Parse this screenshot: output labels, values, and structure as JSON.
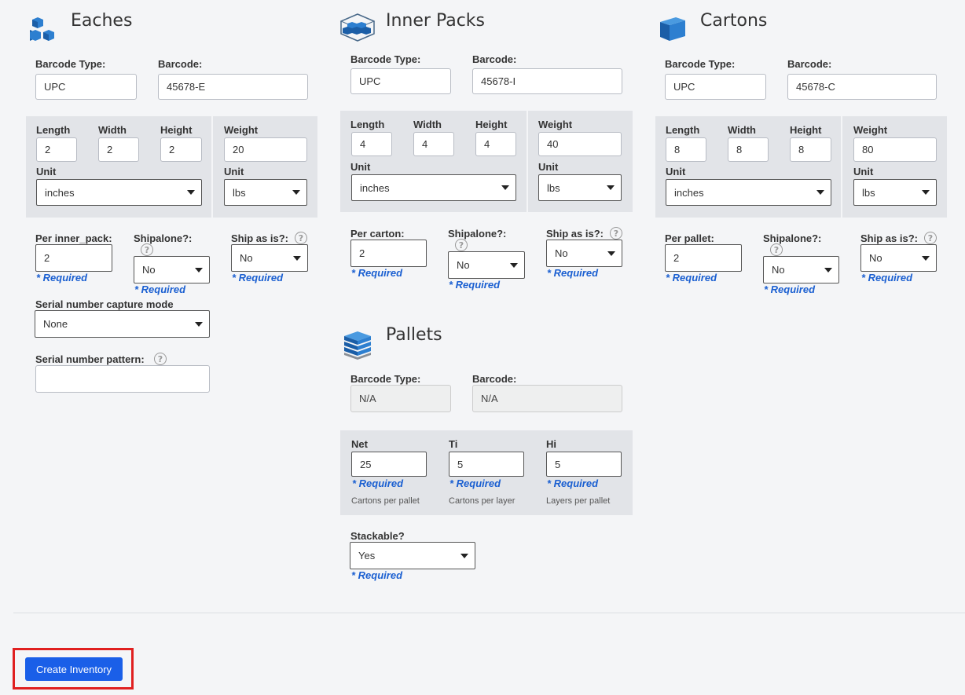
{
  "eaches": {
    "title": "Eaches",
    "barcode_type_label": "Barcode Type:",
    "barcode_type": "UPC",
    "barcode_label": "Barcode:",
    "barcode": "45678-E",
    "length_label": "Length",
    "length": "2",
    "width_label": "Width",
    "width": "2",
    "height_label": "Height",
    "height": "2",
    "weight_label": "Weight",
    "weight": "20",
    "unit_label": "Unit",
    "unit": "inches",
    "weight_unit_label": "Unit",
    "weight_unit": "lbs",
    "per_label": "Per inner_pack:",
    "per_value": "2",
    "shipalone_label": "Shipalone?:",
    "shipalone": "No",
    "ship_as_is_label": "Ship as is?:",
    "ship_as_is": "No",
    "serial_mode_label": "Serial number capture mode",
    "serial_mode": "None",
    "serial_pattern_label": "Serial number pattern:",
    "serial_pattern": ""
  },
  "inner_packs": {
    "title": "Inner Packs",
    "barcode_type_label": "Barcode Type:",
    "barcode_type": "UPC",
    "barcode_label": "Barcode:",
    "barcode": "45678-I",
    "length_label": "Length",
    "length": "4",
    "width_label": "Width",
    "width": "4",
    "height_label": "Height",
    "height": "4",
    "weight_label": "Weight",
    "weight": "40",
    "unit_label": "Unit",
    "unit": "inches",
    "weight_unit_label": "Unit",
    "weight_unit": "lbs",
    "per_label": "Per carton:",
    "per_value": "2",
    "shipalone_label": "Shipalone?:",
    "shipalone": "No",
    "ship_as_is_label": "Ship as is?:",
    "ship_as_is": "No"
  },
  "cartons": {
    "title": "Cartons",
    "barcode_type_label": "Barcode Type:",
    "barcode_type": "UPC",
    "barcode_label": "Barcode:",
    "barcode": "45678-C",
    "length_label": "Length",
    "length": "8",
    "width_label": "Width",
    "width": "8",
    "height_label": "Height",
    "height": "8",
    "weight_label": "Weight",
    "weight": "80",
    "unit_label": "Unit",
    "unit": "inches",
    "weight_unit_label": "Unit",
    "weight_unit": "lbs",
    "per_label": "Per pallet:",
    "per_value": "2",
    "shipalone_label": "Shipalone?:",
    "shipalone": "No",
    "ship_as_is_label": "Ship as is?:",
    "ship_as_is": "No"
  },
  "pallets": {
    "title": "Pallets",
    "barcode_type_label": "Barcode Type:",
    "barcode_type": "N/A",
    "barcode_label": "Barcode:",
    "barcode": "N/A",
    "net_label": "Net",
    "net": "25",
    "net_hint": "Cartons per pallet",
    "ti_label": "Ti",
    "ti": "5",
    "ti_hint": "Cartons per layer",
    "hi_label": "Hi",
    "hi": "5",
    "hi_hint": "Layers per pallet",
    "stackable_label": "Stackable?",
    "stackable": "Yes"
  },
  "required_text": "* Required",
  "help_glyph": "?",
  "create_button_label": "Create Inventory",
  "colors": {
    "accent": "#1a5fe8",
    "required": "#1a5fd1",
    "highlight": "#e02020"
  },
  "icons": {
    "eaches": "stacked-cubes-icon",
    "inner_packs": "packaged-cubes-icon",
    "cartons": "box-icon",
    "pallets": "pallet-stack-icon"
  }
}
